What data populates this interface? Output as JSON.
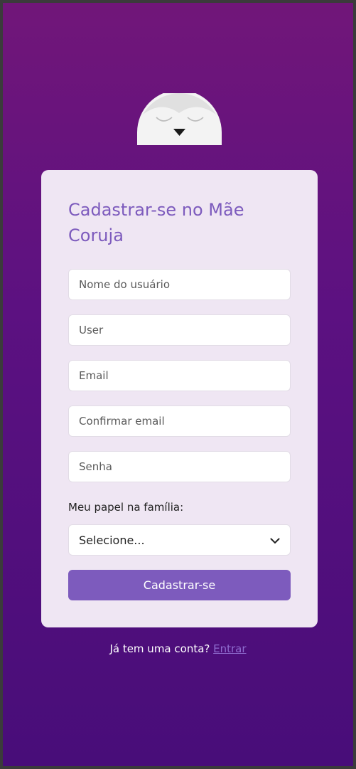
{
  "colors": {
    "background_top": "#711679",
    "background_bottom": "#480d79",
    "card": "#efe6f3",
    "accent": "#7d5bbd",
    "link": "#8f6ccf"
  },
  "logo": {
    "icon": "sleeping-owl-icon"
  },
  "form": {
    "title": "Cadastrar-se no Mãe Coruja",
    "fields": {
      "name_placeholder": "Nome do usuário",
      "user_placeholder": "User",
      "email_placeholder": "Email",
      "confirm_email_placeholder": "Confirmar email",
      "password_placeholder": "Senha"
    },
    "role_label": "Meu papel na família:",
    "role_select": {
      "value": "Selecione...",
      "icon": "chevron-down-icon"
    },
    "submit_label": "Cadastrar-se"
  },
  "footer": {
    "text": "Já tem uma conta?",
    "link_label": "Entrar"
  }
}
